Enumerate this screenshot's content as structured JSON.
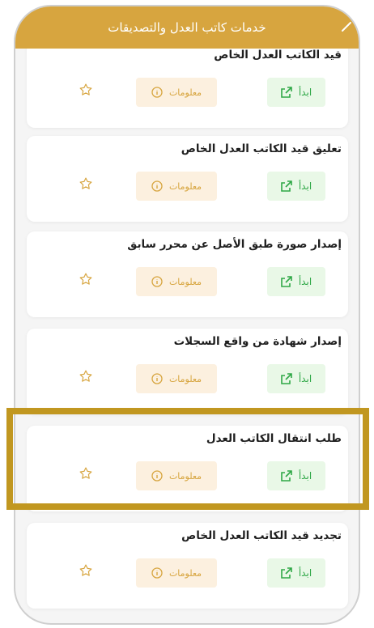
{
  "header": {
    "title": "خدمات كاتب العدل والتصديقات",
    "back_icon": "chevron-icon"
  },
  "services": [
    {
      "title": "قيد الكاتب العدل الخاص",
      "start_label": "ابدأ",
      "info_label": "معلومات"
    },
    {
      "title": "تعليق قيد الكاتب العدل الخاص",
      "start_label": "ابدأ",
      "info_label": "معلومات"
    },
    {
      "title": "إصدار صورة طبق الأصل عن محرر سابق",
      "start_label": "ابدأ",
      "info_label": "معلومات"
    },
    {
      "title": "إصدار شهادة من واقع السجلات",
      "start_label": "ابدأ",
      "info_label": "معلومات"
    },
    {
      "title": "طلب انتقال الكاتب العدل",
      "start_label": "ابدأ",
      "info_label": "معلومات"
    },
    {
      "title": "تجديد قيد الكاتب العدل الخاص",
      "start_label": "ابدأ",
      "info_label": "معلومات"
    }
  ],
  "colors": {
    "header": "#d7a53f",
    "start_bg": "#e9f8e7",
    "start_text": "#2fa847",
    "info_bg": "#fcf0df",
    "info_text": "#d7a53f",
    "highlight": "#c19720"
  }
}
